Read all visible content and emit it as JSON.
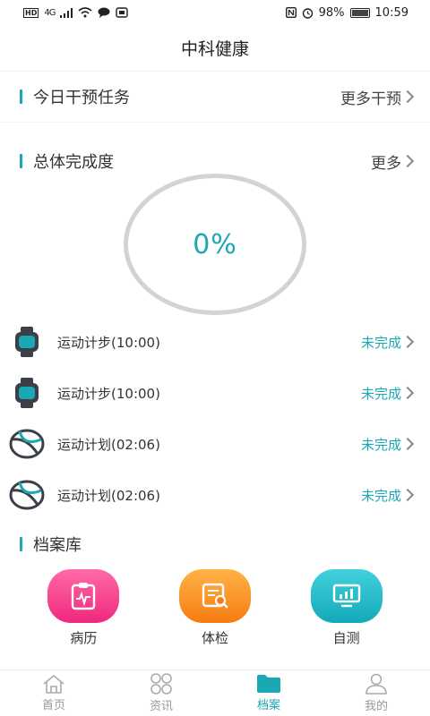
{
  "status_bar": {
    "hd": "HD",
    "network": "4G",
    "battery_pct": "98%",
    "time": "10:59"
  },
  "header": {
    "title": "中科健康"
  },
  "today_tasks": {
    "title": "今日干预任务",
    "more": "更多干预"
  },
  "overall": {
    "title": "总体完成度",
    "more": "更多",
    "progress_text": "0%"
  },
  "tasks": [
    {
      "name": "运动计步(10:00)",
      "status": "未完成",
      "icon": "smartwatch-icon"
    },
    {
      "name": "运动计步(10:00)",
      "status": "未完成",
      "icon": "smartwatch-icon"
    },
    {
      "name": "运动计划(02:06)",
      "status": "未完成",
      "icon": "ball-icon"
    },
    {
      "name": "运动计划(02:06)",
      "status": "未完成",
      "icon": "ball-icon"
    }
  ],
  "archive": {
    "title": "档案库",
    "items": [
      {
        "label": "病历",
        "icon": "medical-record-icon",
        "color_top": "#ff6aa8",
        "color_bottom": "#f0287e"
      },
      {
        "label": "体检",
        "icon": "checkup-icon",
        "color_top": "#ffb347",
        "color_bottom": "#f57c12"
      },
      {
        "label": "自测",
        "icon": "monitor-icon",
        "color_top": "#42d0de",
        "color_bottom": "#13a9b8"
      }
    ]
  },
  "tabbar": {
    "items": [
      {
        "label": "首页",
        "icon": "home-icon",
        "active": false
      },
      {
        "label": "资讯",
        "icon": "grid-icon",
        "active": false
      },
      {
        "label": "档案",
        "icon": "folder-icon",
        "active": true
      },
      {
        "label": "我的",
        "icon": "user-icon",
        "active": false
      }
    ]
  },
  "colors": {
    "accent": "#1aa8b4",
    "ring": "#d3d3d3"
  }
}
